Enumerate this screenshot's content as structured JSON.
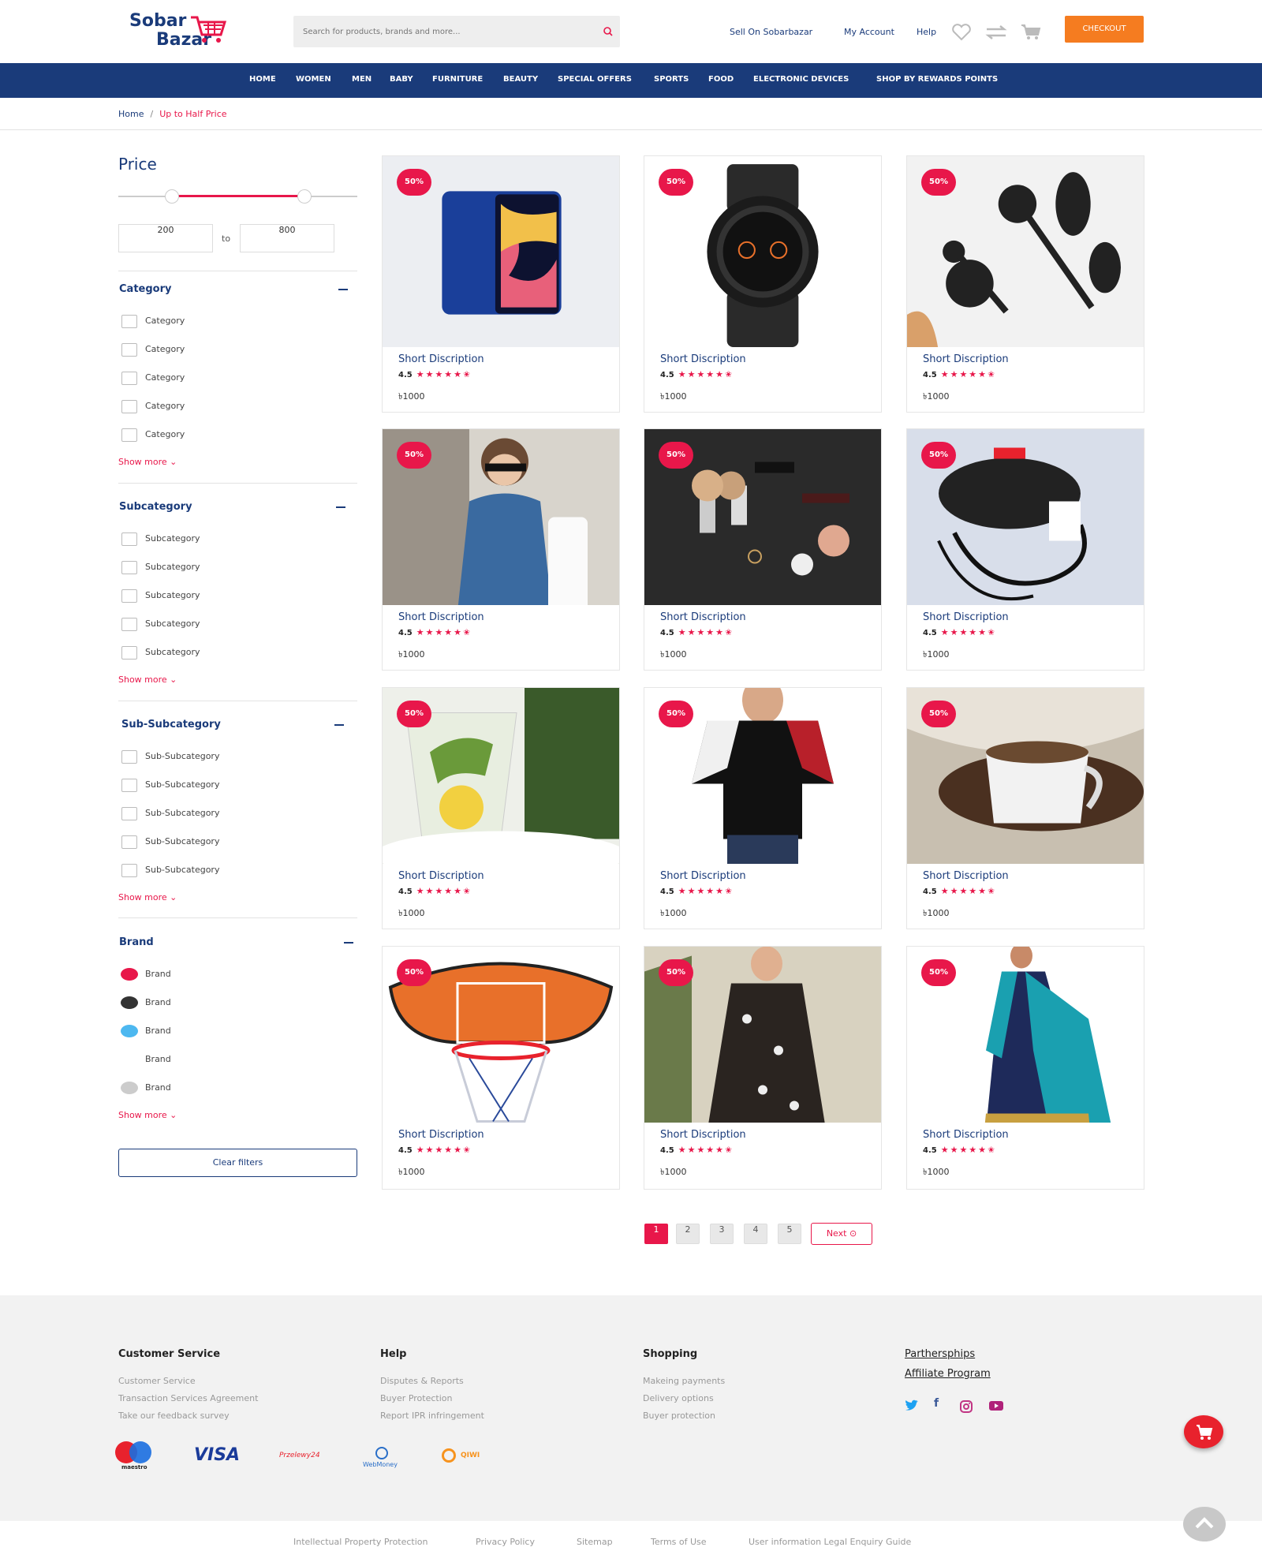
{
  "header": {
    "logo_top": "Sobar",
    "logo_bottom": "Bazar",
    "search_placeholder": "Search for products, brands and more...",
    "links": [
      "Sell On Sobarbazar",
      "My Account",
      "Help"
    ],
    "checkout": "CHECKOUT"
  },
  "nav": [
    "HOME",
    "WOMEN",
    "MEN",
    "BABY",
    "FURNITURE",
    "BEAUTY",
    "SPECIAL OFFERS",
    "SPORTS",
    "FOOD",
    "ELECTRONIC DEVICES",
    "SHOP BY REWARDS POINTS"
  ],
  "breadcrumb": {
    "home": "Home",
    "sep": "/",
    "current": "Up to Half Price"
  },
  "filters": {
    "price_title": "Price",
    "min": "200",
    "to": "to",
    "max": "800",
    "groups": [
      {
        "title": "Category",
        "options": [
          "Category",
          "Category",
          "Category",
          "Category",
          "Category"
        ],
        "more": "Show more"
      },
      {
        "title": "Subcategory",
        "options": [
          "Subcategory",
          "Subcategory",
          "Subcategory",
          "Subcategory",
          "Subcategory"
        ],
        "more": "Show more"
      },
      {
        "title": "Sub-Subcategory",
        "options": [
          "Sub-Subcategory",
          "Sub-Subcategory",
          "Sub-Subcategory",
          "Sub-Subcategory",
          "Sub-Subcategory"
        ],
        "more": "Show more"
      },
      {
        "title": "Brand",
        "options": [
          "Brand",
          "Brand",
          "Brand",
          "Brand",
          "Brand"
        ],
        "more": "Show more"
      }
    ],
    "brand_colors": [
      "#e8174a",
      "#333333",
      "#4db8f0",
      "",
      "#cccccc"
    ],
    "clear": "Clear filters"
  },
  "product": {
    "badge": "50%",
    "desc": "Short Discription",
    "rating": "4.5",
    "stars": "★★★★★✬",
    "price": "৳1000"
  },
  "products": [
    {
      "icon": "smartphone-image"
    },
    {
      "icon": "smartwatch-image"
    },
    {
      "icon": "kitchen-utensils-image"
    },
    {
      "icon": "kid-fashion-image"
    },
    {
      "icon": "cosmetics-image"
    },
    {
      "icon": "earphones-case-image"
    },
    {
      "icon": "lemon-drink-image"
    },
    {
      "icon": "tshirt-image"
    },
    {
      "icon": "coffee-mug-image"
    },
    {
      "icon": "basketball-hoop-image"
    },
    {
      "icon": "floral-dress-image"
    },
    {
      "icon": "saree-image"
    }
  ],
  "pagination": {
    "pages": [
      "1",
      "2",
      "3",
      "4",
      "5"
    ],
    "next": "Next"
  },
  "footer": {
    "columns": [
      {
        "title": "Customer Service",
        "links": [
          "Customer Service",
          "Transaction Services Agreement",
          "Take our feedback survey"
        ]
      },
      {
        "title": "Help",
        "links": [
          "Disputes & Reports",
          "Buyer Protection",
          "Report IPR infringement"
        ]
      },
      {
        "title": "Shopping",
        "links": [
          "Makeing payments",
          "Delivery options",
          "Buyer protection"
        ]
      }
    ],
    "partner_links": [
      "Parthersphips",
      "Affiliate Program"
    ],
    "payments": [
      "maestro",
      "VISA",
      "Przelewy24",
      "WebMoney",
      "QIWI"
    ],
    "bottom_links": [
      "Intellectual Property Protection",
      "Privacy Policy",
      "Sitemap",
      "Terms of Use",
      "User information Legal Enquiry Guide"
    ]
  }
}
